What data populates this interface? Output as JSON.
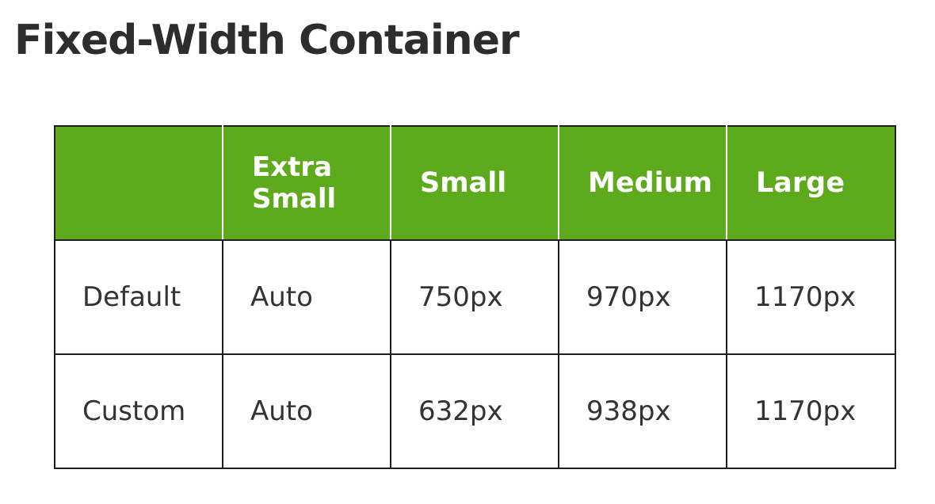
{
  "title": "Fixed-Width Container",
  "table": {
    "columns": [
      "",
      "Extra Small",
      "Small",
      "Medium",
      "Large"
    ],
    "header_extra_small": {
      "line1": "Extra",
      "line2": "Small"
    },
    "rows": [
      {
        "label": "Default",
        "cells": [
          "Auto",
          "750px",
          "970px",
          "1170px"
        ]
      },
      {
        "label": "Custom",
        "cells": [
          "Auto",
          "632px",
          "938px",
          "1170px"
        ]
      }
    ]
  },
  "colors": {
    "header_bg": "#5daa1d",
    "header_text": "#ffffff",
    "border": "#1f1f1f",
    "title_text": "#2d2d2d"
  }
}
